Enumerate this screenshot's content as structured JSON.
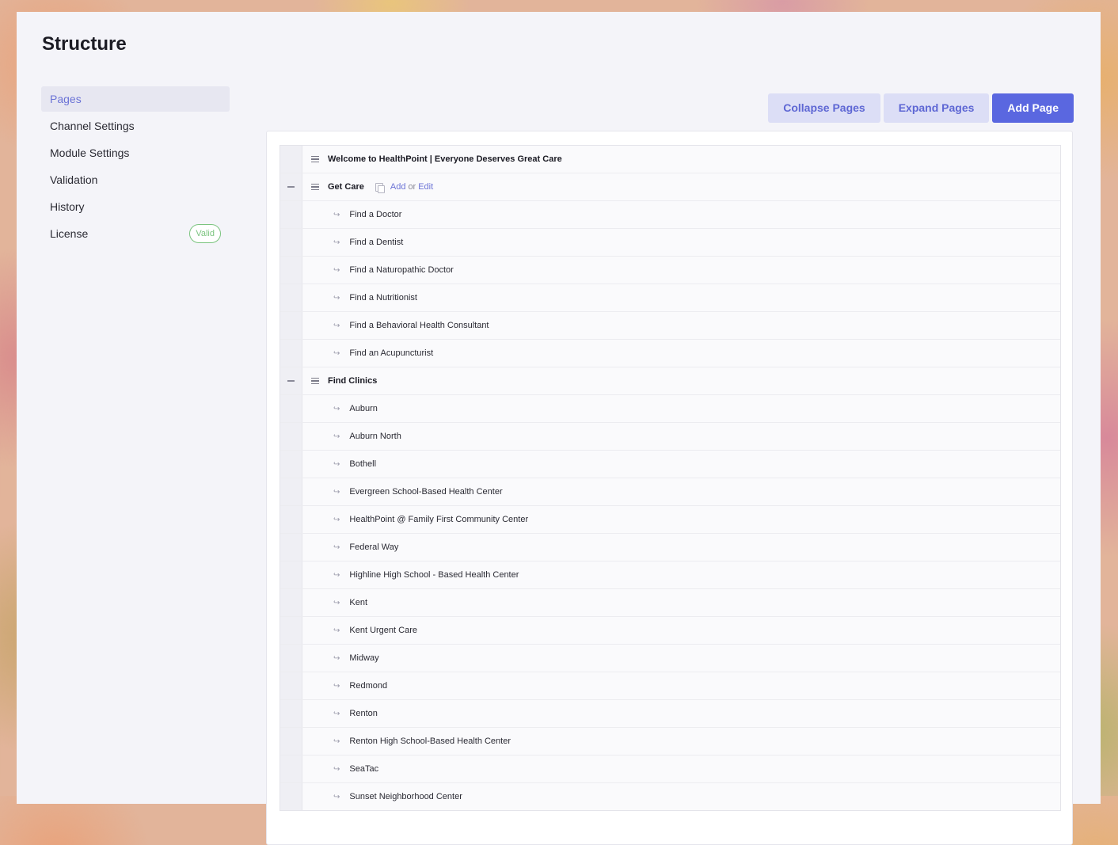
{
  "page": {
    "title": "Structure"
  },
  "sidebar": {
    "items": [
      {
        "label": "Pages"
      },
      {
        "label": "Channel Settings"
      },
      {
        "label": "Module Settings"
      },
      {
        "label": "Validation"
      },
      {
        "label": "History"
      },
      {
        "label": "License",
        "badge": "Valid"
      }
    ],
    "active": "Pages"
  },
  "toolbar": {
    "collapse_label": "Collapse Pages",
    "expand_label": "Expand Pages",
    "add_label": "Add Page"
  },
  "tree": {
    "welcome": "Welcome to HealthPoint | Everyone Deserves Great Care",
    "get_care": {
      "label": "Get Care",
      "add_label": "Add",
      "or_label": "or",
      "edit_label": "Edit",
      "children": [
        "Find a Doctor",
        "Find a Dentist",
        "Find a Naturopathic Doctor",
        "Find a Nutritionist",
        "Find a Behavioral Health Consultant",
        "Find an Acupuncturist"
      ]
    },
    "find_clinics": {
      "label": "Find Clinics",
      "children": [
        "Auburn",
        "Auburn North",
        "Bothell",
        "Evergreen School-Based Health Center",
        "HealthPoint @ Family First Community Center",
        "Federal Way",
        "Highline High School - Based Health Center",
        "Kent",
        "Kent Urgent Care",
        "Midway",
        "Redmond",
        "Renton",
        "Renton High School-Based Health Center",
        "SeaTac",
        "Sunset Neighborhood Center"
      ]
    }
  },
  "colors": {
    "accent": "#5a67e0",
    "valid": "#7bc47f"
  }
}
